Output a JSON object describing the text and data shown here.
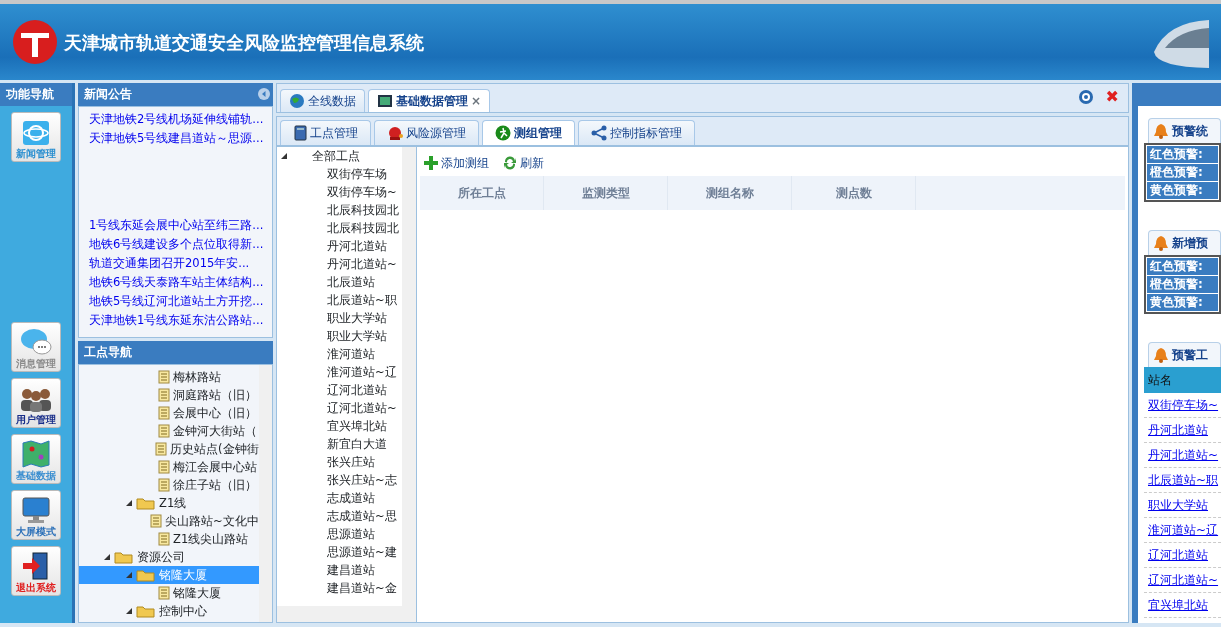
{
  "header": {
    "title": "天津城市轨道交通安全风险监控管理信息系统"
  },
  "function_nav": {
    "title": "功能导航",
    "buttons": [
      {
        "label": "新闻管理",
        "kind": "globe",
        "color": "#2a8fd0"
      },
      {
        "label": "消息管理",
        "kind": "chat",
        "color": "#8a8a8a"
      },
      {
        "label": "用户管理",
        "kind": "users",
        "color": "#1a2f8a"
      },
      {
        "label": "基础数据",
        "kind": "map",
        "color": "#3a8ed0"
      },
      {
        "label": "大屏模式",
        "kind": "monitor",
        "color": "#2a6fb8"
      },
      {
        "label": "退出系统",
        "kind": "exit",
        "color": "#e02020"
      }
    ]
  },
  "news": {
    "title": "新闻公告",
    "blocks": [
      [
        "天津地铁2号线机场延伸线铺轨...",
        "天津地铁5号线建昌道站～思源..."
      ],
      [
        "1号线东延会展中心站至纬三路...",
        "地铁6号线建设多个点位取得新...",
        "轨道交通集团召开2015年安...",
        "地铁6号线天泰路车站主体结构...",
        "地铁5号线辽河北道站土方开挖...",
        "天津地铁1号线东延东沽公路站..."
      ]
    ]
  },
  "workpoint_nav": {
    "title": "工点导航",
    "tree": [
      {
        "children": [
          {
            "children": [
              {
                "label": "梅林路站",
                "selected": false
              },
              {
                "label": "洞庭路站（旧）",
                "selected": false
              },
              {
                "label": "会展中心（旧）",
                "selected": false
              },
              {
                "label": "金钟河大街站（",
                "selected": false
              },
              {
                "label": "历史站点(金钟街",
                "selected": false
              },
              {
                "label": "梅江会展中心站",
                "selected": false
              },
              {
                "label": "徐庄子站（旧）",
                "selected": false
              }
            ]
          },
          {
            "label": "Z1线",
            "selected": false,
            "expanded": true,
            "children": [
              {
                "label": "尖山路站~文化中",
                "selected": false
              },
              {
                "label": "Z1线尖山路站",
                "selected": false
              }
            ]
          }
        ]
      },
      {
        "label": "资源公司",
        "selected": false,
        "expanded": true,
        "children": [
          {
            "label": "铭隆大厦",
            "selected": true,
            "expanded": true,
            "children": [
              {
                "label": "铭隆大厦",
                "selected": false
              }
            ]
          },
          {
            "label": "控制中心",
            "selected": false,
            "expanded": true
          }
        ]
      }
    ]
  },
  "main_tabs": [
    {
      "label": "全线数据",
      "kind": "globe",
      "selected": false
    },
    {
      "label": "基础数据管理",
      "kind": "screen",
      "selected": true,
      "close_symbol": "×"
    }
  ],
  "close_all_symbol": "✖",
  "sub_tabs": [
    {
      "label": "工点管理",
      "kind": "book",
      "selected": false
    },
    {
      "label": "风险源管理",
      "kind": "alarm",
      "selected": false
    },
    {
      "label": "测组管理",
      "kind": "runner",
      "selected": true
    },
    {
      "label": "控制指标管理",
      "kind": "share",
      "selected": false
    }
  ],
  "site_tree": {
    "root": "全部工点",
    "expanded": true,
    "children": [
      "双街停车场",
      "双街停车场~",
      "北辰科技园北",
      "北辰科技园北",
      "丹河北道站",
      "丹河北道站~",
      "北辰道站",
      "北辰道站~职",
      "职业大学站",
      "职业大学站",
      "淮河道站",
      "淮河道站~辽",
      "辽河北道站",
      "辽河北道站~",
      "宜兴埠北站",
      "新宜白大道",
      "张兴庄站",
      "张兴庄站~志",
      "志成道站",
      "志成道站~思",
      "思源道站",
      "思源道站~建",
      "建昌道站",
      "建昌道站~金"
    ]
  },
  "toolbar": [
    {
      "label": "添加测组",
      "kind": "add"
    },
    {
      "label": "刷新",
      "kind": "refresh"
    }
  ],
  "grid": {
    "columns": [
      "所在工点",
      "监测类型",
      "测组名称",
      "测点数"
    ]
  },
  "right_panel": {
    "boxes": [
      {
        "title": "预警统",
        "rows": [
          "红色预警:",
          "橙色预警:",
          "黄色预警:"
        ]
      },
      {
        "title": "新增预",
        "rows": [
          "红色预警:",
          "橙色预警:",
          "黄色预警:"
        ]
      }
    ],
    "stations": {
      "title": "预警工",
      "column": "站名",
      "rows": [
        "双街停车场~",
        "丹河北道站",
        "丹河北道站~",
        "北辰道站~职",
        "职业大学站",
        "淮河道站~辽",
        "辽河北道站",
        "辽河北道站~",
        "宜兴埠北站"
      ]
    }
  }
}
